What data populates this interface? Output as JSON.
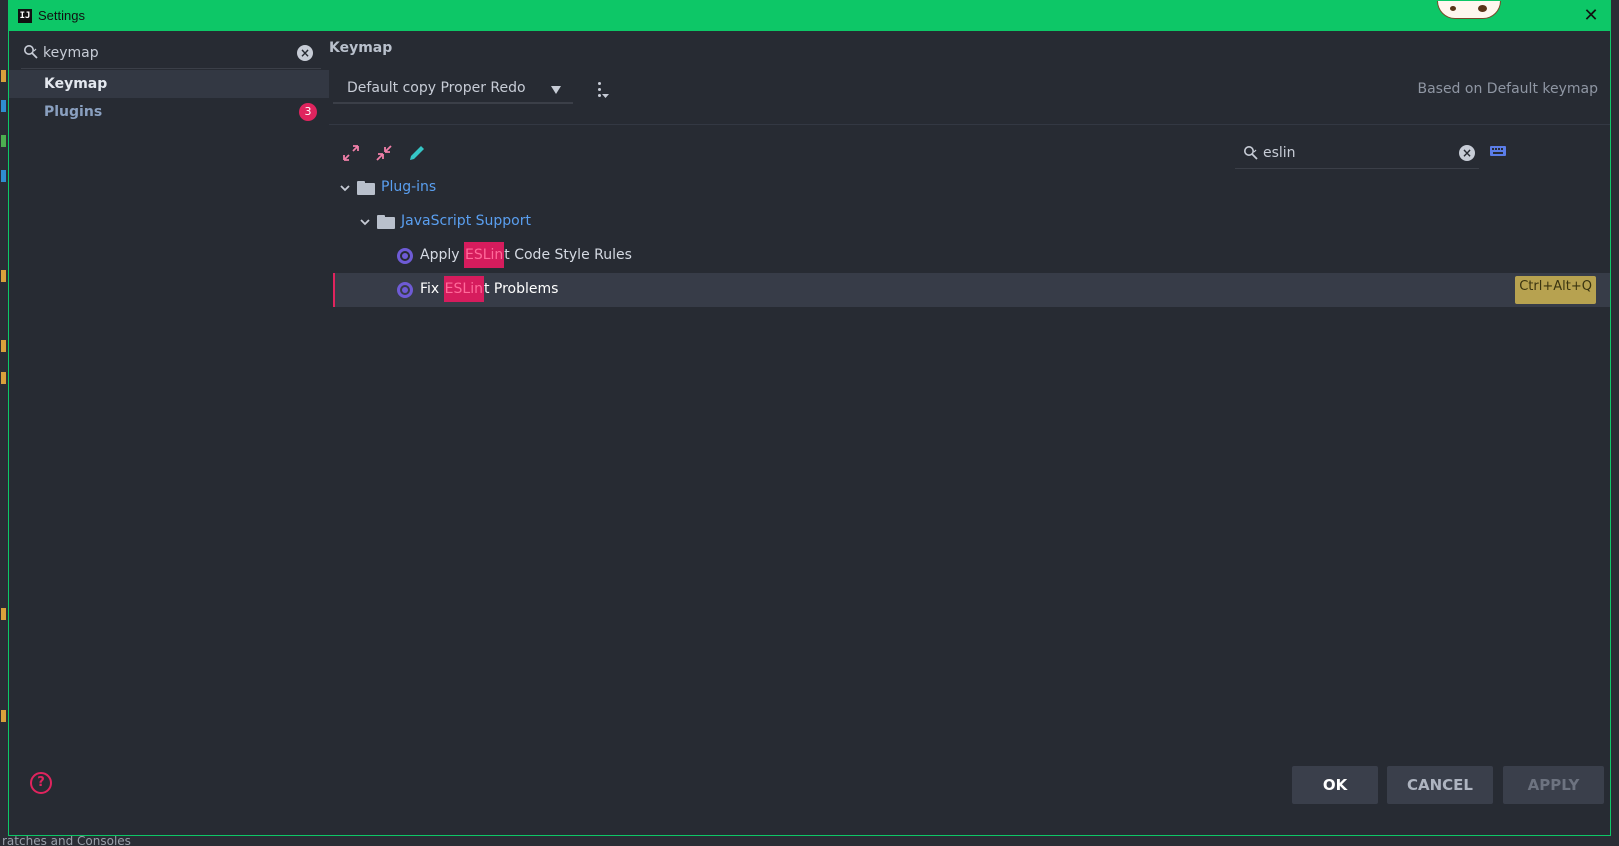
{
  "window": {
    "title": "Settings",
    "app_icon_label": "IJ",
    "close_label": "✕",
    "accent_color": "#0dc767"
  },
  "sidebar": {
    "search": {
      "value": "keymap",
      "placeholder": ""
    },
    "items": [
      {
        "label": "Keymap",
        "selected": true
      },
      {
        "label": "Plugins",
        "badge": "3"
      }
    ],
    "help_label": "?"
  },
  "main": {
    "title": "Keymap",
    "keymap_select": {
      "value": "Default copy Proper Redo"
    },
    "based_on": "Based on Default keymap",
    "toolbar": {
      "icons": [
        "expand-all-icon",
        "collapse-all-icon",
        "edit-pencil-icon"
      ]
    },
    "action_search": {
      "value": "eslin"
    },
    "tree": {
      "root": {
        "label": "Plug-ins",
        "expanded": true
      },
      "group": {
        "label": "JavaScript Support",
        "expanded": true
      },
      "actions": [
        {
          "prefix": "Apply ",
          "match": "ESLin",
          "suffix": "t Code Style Rules",
          "shortcut": ""
        },
        {
          "prefix": "Fix ",
          "match": "ESLin",
          "suffix": "t Problems",
          "shortcut": "Ctrl+Alt+Q",
          "selected": true
        }
      ]
    }
  },
  "buttons": {
    "ok": "OK",
    "cancel": "CANCEL",
    "apply": "APPLY"
  },
  "background": {
    "bottom_text": "ratches and Consoles"
  },
  "colors": {
    "highlight": "#d61c5d",
    "badge": "#e0245e",
    "link": "#5a9ff0",
    "shortcut_bg": "#b7a250"
  }
}
